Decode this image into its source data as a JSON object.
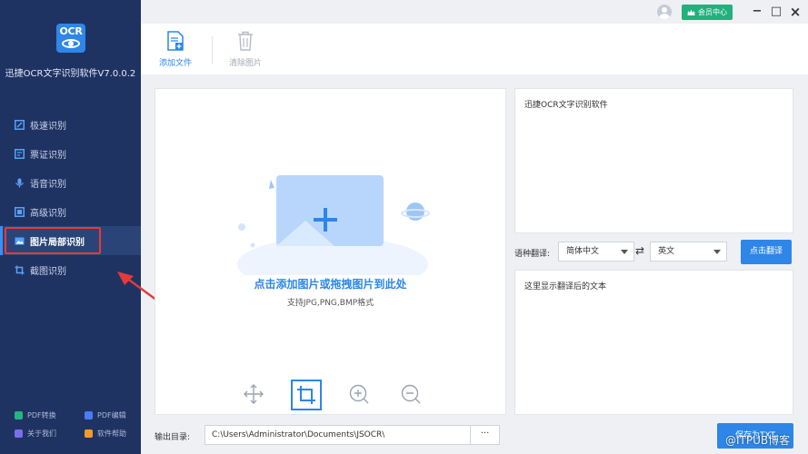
{
  "app": {
    "logo_text": "OCR",
    "title": "迅捷OCR文字识别软件V7.0.0.2"
  },
  "sidebar": {
    "items": [
      {
        "label": "极速识别",
        "icon": "quick-scan-icon"
      },
      {
        "label": "票证识别",
        "icon": "ticket-icon"
      },
      {
        "label": "语音识别",
        "icon": "microphone-icon"
      },
      {
        "label": "高级识别",
        "icon": "advanced-icon"
      },
      {
        "label": "图片局部识别",
        "icon": "image-region-icon",
        "active": true
      },
      {
        "label": "截图识别",
        "icon": "screenshot-icon"
      }
    ],
    "footer": [
      {
        "label": "PDF转换",
        "icon": "pdf-convert-icon",
        "color": "#28b481"
      },
      {
        "label": "PDF编辑",
        "icon": "pdf-edit-icon",
        "color": "#4c7cf0"
      },
      {
        "label": "关于我们",
        "icon": "about-icon",
        "color": "#7b6cf0"
      },
      {
        "label": "软件帮助",
        "icon": "help-icon",
        "color": "#f39a2a"
      }
    ]
  },
  "header": {
    "vip_label": "会员中心",
    "minimize": "−",
    "maximize": "□",
    "close": "×"
  },
  "toolbar": {
    "add_file_label": "添加文件",
    "clear_images_label": "清除图片"
  },
  "upload": {
    "title": "点击添加图片或拖拽图片到此处",
    "subtitle": "支持JPG,PNG,BMP格式"
  },
  "output": {
    "label": "输出目录:",
    "path": "C:\\Users\\Administrator\\Documents\\JSOCR\\",
    "browse": "···"
  },
  "result": {
    "text": "迅捷OCR文字识别软件"
  },
  "translate": {
    "label": "语种翻译:",
    "source_lang": "简体中文",
    "target_lang": "英文",
    "swap_glyph": "⇄",
    "button": "点击翻译",
    "placeholder": "这里显示翻译后的文本"
  },
  "save": {
    "label": "保存为TXT"
  },
  "watermark": {
    "text": "@ITPUB博客"
  },
  "colors": {
    "sidebar_bg": "#1f3363",
    "accent": "#2d86e8",
    "vip": "#22b07d",
    "highlight": "#e53a3a"
  }
}
